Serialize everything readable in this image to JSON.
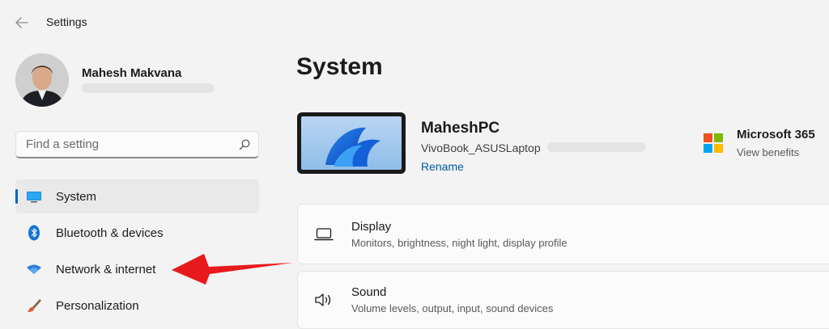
{
  "app": {
    "title": "Settings"
  },
  "profile": {
    "name": "Mahesh Makvana"
  },
  "search": {
    "placeholder": "Find a setting"
  },
  "nav": {
    "items": [
      {
        "label": "System"
      },
      {
        "label": "Bluetooth & devices"
      },
      {
        "label": "Network & internet"
      },
      {
        "label": "Personalization"
      }
    ]
  },
  "main": {
    "title": "System",
    "device": {
      "name": "MaheshPC",
      "model": "VivoBook_ASUSLaptop",
      "rename": "Rename"
    },
    "ms365": {
      "title": "Microsoft 365",
      "subtitle": "View benefits"
    },
    "cards": [
      {
        "title": "Display",
        "subtitle": "Monitors, brightness, night light, display profile"
      },
      {
        "title": "Sound",
        "subtitle": "Volume levels, output, input, sound devices"
      }
    ]
  },
  "colors": {
    "accent": "#0067c0",
    "link": "#005a9e",
    "annotation_arrow": "#e8191c"
  },
  "icons": {
    "back": "back-arrow-icon",
    "search": "search-icon",
    "system": "monitor-icon",
    "bluetooth": "bluetooth-icon",
    "network": "wifi-icon",
    "personalization": "brush-icon",
    "display": "laptop-icon",
    "sound": "speaker-icon"
  }
}
